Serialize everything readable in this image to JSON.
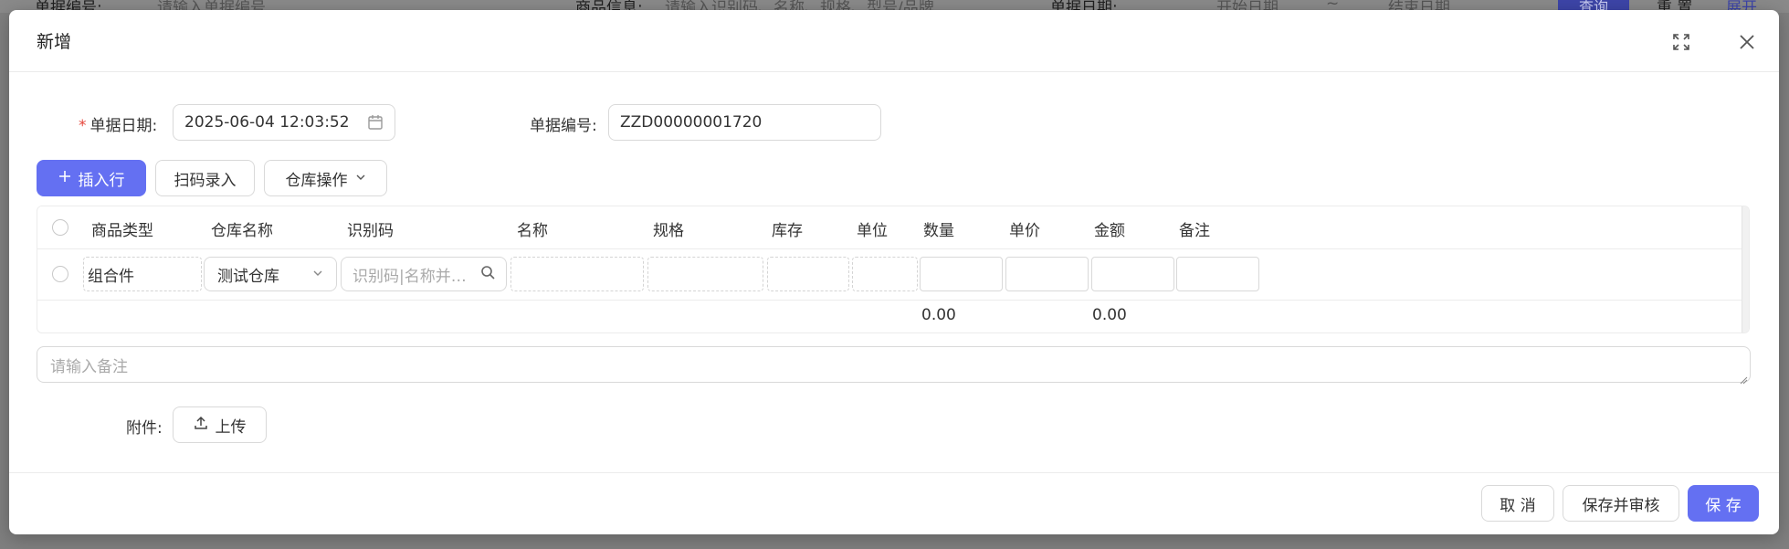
{
  "background": {
    "doc_no_label": "单据编号:",
    "doc_no_placeholder": "请输入单据编号",
    "goods_label": "商品信息:",
    "goods_placeholder": "请输入识别码、名称、规格、型号/品牌",
    "date_label": "单据日期:",
    "start_placeholder": "开始日期",
    "tilde": "~",
    "end_placeholder": "结束日期",
    "query_label": "查询",
    "reset_label": "重 置",
    "expand_label": "展开"
  },
  "modal": {
    "title": "新增",
    "icons": {
      "maximize": "maximize-icon",
      "close": "close-icon"
    }
  },
  "form": {
    "date_label": "单据日期:",
    "date_value": "2025-06-04 12:03:52",
    "no_label": "单据编号:",
    "no_value": "ZZD00000001720"
  },
  "toolbar": {
    "insert_row": "插入行",
    "scan_entry": "扫码录入",
    "warehouse_ops": "仓库操作"
  },
  "table": {
    "columns": [
      "商品类型",
      "仓库名称",
      "识别码",
      "名称",
      "规格",
      "库存",
      "单位",
      "数量",
      "单价",
      "金额",
      "备注"
    ],
    "rows": [
      {
        "type": "组合件",
        "warehouse": "测试仓库",
        "code_placeholder": "识别码|名称并…"
      }
    ],
    "summary": {
      "quantity_total": "0.00",
      "amount_total": "0.00"
    }
  },
  "remark": {
    "placeholder": "请输入备注"
  },
  "attachment": {
    "label": "附件:",
    "upload": "上传"
  },
  "footer": {
    "cancel": "取 消",
    "save_audit": "保存并审核",
    "save": "保 存"
  },
  "colors": {
    "primary": "#6470f2",
    "required": "#e5453b"
  }
}
